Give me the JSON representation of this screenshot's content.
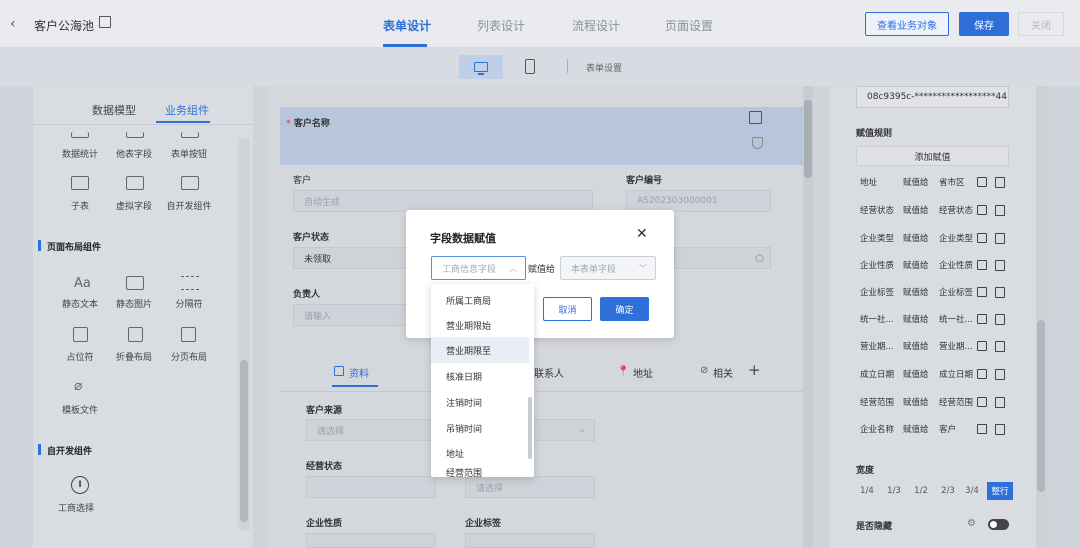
{
  "header": {
    "back_icon": "‹",
    "title": "客户公海池",
    "tabs": [
      "表单设计",
      "列表设计",
      "流程设计",
      "页面设置"
    ],
    "active_tab": 0,
    "btn_view_objects": "查看业务对象",
    "btn_save": "保存",
    "btn_close": "关闭"
  },
  "devicebar": {
    "settings_label": "表单设置"
  },
  "leftpanel": {
    "tabs": [
      "数据模型",
      "业务组件"
    ],
    "active_tab": 1,
    "row0": [
      "数据统计",
      "他表字段",
      "表单按钮"
    ],
    "row1": [
      "子表",
      "虚拟字段",
      "自开发组件"
    ],
    "section_layout": "页面布局组件",
    "row2": [
      "静态文本",
      "静态图片",
      "分隔符"
    ],
    "row3": [
      "占位符",
      "折叠布局",
      "分页布局"
    ],
    "row4": [
      "模板文件"
    ],
    "section_custom": "自开发组件",
    "row5": [
      "工商选择"
    ]
  },
  "form": {
    "customer_name_label": "客户名称",
    "customer_label": "客户",
    "customer_placeholder": "自动生成",
    "customer_no_label": "客户编号",
    "customer_no_value": "AS202303000001",
    "status_label": "客户状态",
    "status_value": "未领取",
    "owner_label": "负责人",
    "owner_placeholder": "请输入",
    "subtabs": [
      "资料",
      "联系人",
      "地址",
      "相关"
    ],
    "source_label": "客户来源",
    "source_placeholder": "请选择",
    "source2_placeholder": "请选择",
    "biz_status_label": "经营状态",
    "biz_status_placeholder": "请选择",
    "nature_label": "企业性质",
    "tag_label": "企业标签",
    "nature_placeholder": "请选择"
  },
  "rightpanel": {
    "id_value": "08c9395c-******************44",
    "rules_label": "赋值规则",
    "add_rule_btn": "添加赋值",
    "rules": [
      {
        "src": "地址",
        "op": "赋值给",
        "dst": "省市区"
      },
      {
        "src": "经营状态",
        "op": "赋值给",
        "dst": "经营状态"
      },
      {
        "src": "企业类型",
        "op": "赋值给",
        "dst": "企业类型"
      },
      {
        "src": "企业性质",
        "op": "赋值给",
        "dst": "企业性质"
      },
      {
        "src": "企业标签",
        "op": "赋值给",
        "dst": "企业标签"
      },
      {
        "src": "统一社...",
        "op": "赋值给",
        "dst": "统一社..."
      },
      {
        "src": "营业期...",
        "op": "赋值给",
        "dst": "营业期..."
      },
      {
        "src": "成立日期",
        "op": "赋值给",
        "dst": "成立日期"
      },
      {
        "src": "经营范围",
        "op": "赋值给",
        "dst": "经营范围"
      },
      {
        "src": "企业名称",
        "op": "赋值给",
        "dst": "客户"
      }
    ],
    "width_label": "宽度",
    "widths": [
      "1/4",
      "1/3",
      "1/2",
      "2/3",
      "3/4",
      "整行"
    ],
    "active_width": 5,
    "hidden_label": "是否隐藏"
  },
  "dialog": {
    "title": "字段数据赋值",
    "close_icon": "✕",
    "source_placeholder": "工商信息字段",
    "assign_label": "赋值给",
    "target_placeholder": "本表单字段",
    "cancel": "取消",
    "ok": "确定"
  },
  "dropdown": {
    "items": [
      "所属工商局",
      "营业期限始",
      "营业期限至",
      "核准日期",
      "注销时间",
      "吊销时间",
      "地址",
      "经营范围"
    ],
    "highlighted": 2
  },
  "colors": {
    "accent": "#2f6fd8"
  }
}
